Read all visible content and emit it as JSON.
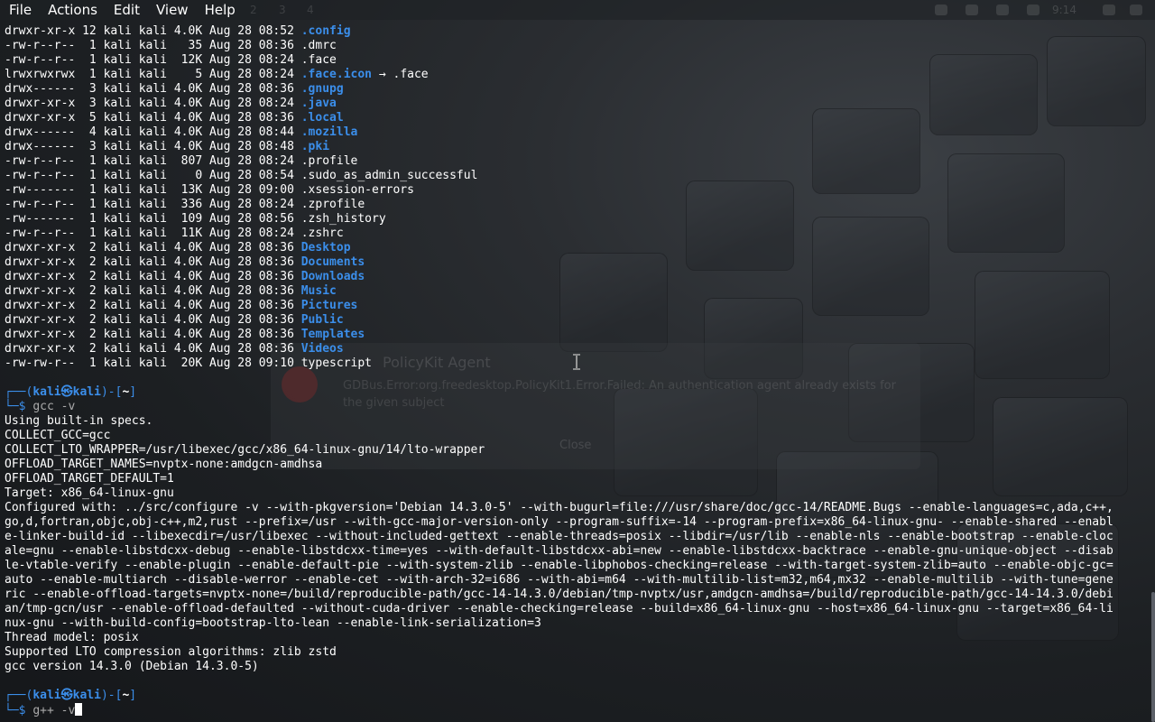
{
  "menubar": {
    "items": [
      "File",
      "Actions",
      "Edit",
      "View",
      "Help"
    ]
  },
  "panel": {
    "workspaces": [
      "1",
      "2",
      "3",
      "4"
    ],
    "clock": "9:14"
  },
  "ghost_dialog": {
    "title": "PolicyKit Agent",
    "text": "GDBus.Error:org.freedesktop.PolicyKit1.Error.Failed: An authentication agent already exists for the given subject",
    "button": "Close"
  },
  "listing": [
    {
      "perms": "drwxr-xr-x",
      "links": "12",
      "user": "kali",
      "group": "kali",
      "size": "4.0K",
      "month": "Aug",
      "day": "28",
      "time": "08:52",
      "name": ".config",
      "kind": "dir"
    },
    {
      "perms": "-rw-r--r--",
      "links": " 1",
      "user": "kali",
      "group": "kali",
      "size": "  35",
      "month": "Aug",
      "day": "28",
      "time": "08:36",
      "name": ".dmrc",
      "kind": "file"
    },
    {
      "perms": "-rw-r--r--",
      "links": " 1",
      "user": "kali",
      "group": "kali",
      "size": " 12K",
      "month": "Aug",
      "day": "28",
      "time": "08:24",
      "name": ".face",
      "kind": "file"
    },
    {
      "perms": "lrwxrwxrwx",
      "links": " 1",
      "user": "kali",
      "group": "kali",
      "size": "   5",
      "month": "Aug",
      "day": "28",
      "time": "08:24",
      "name": ".face.icon",
      "kind": "link",
      "target": " → .face"
    },
    {
      "perms": "drwx------",
      "links": " 3",
      "user": "kali",
      "group": "kali",
      "size": "4.0K",
      "month": "Aug",
      "day": "28",
      "time": "08:36",
      "name": ".gnupg",
      "kind": "dir"
    },
    {
      "perms": "drwxr-xr-x",
      "links": " 3",
      "user": "kali",
      "group": "kali",
      "size": "4.0K",
      "month": "Aug",
      "day": "28",
      "time": "08:24",
      "name": ".java",
      "kind": "dir"
    },
    {
      "perms": "drwxr-xr-x",
      "links": " 5",
      "user": "kali",
      "group": "kali",
      "size": "4.0K",
      "month": "Aug",
      "day": "28",
      "time": "08:36",
      "name": ".local",
      "kind": "dir"
    },
    {
      "perms": "drwx------",
      "links": " 4",
      "user": "kali",
      "group": "kali",
      "size": "4.0K",
      "month": "Aug",
      "day": "28",
      "time": "08:44",
      "name": ".mozilla",
      "kind": "dir"
    },
    {
      "perms": "drwx------",
      "links": " 3",
      "user": "kali",
      "group": "kali",
      "size": "4.0K",
      "month": "Aug",
      "day": "28",
      "time": "08:48",
      "name": ".pki",
      "kind": "dir"
    },
    {
      "perms": "-rw-r--r--",
      "links": " 1",
      "user": "kali",
      "group": "kali",
      "size": " 807",
      "month": "Aug",
      "day": "28",
      "time": "08:24",
      "name": ".profile",
      "kind": "file"
    },
    {
      "perms": "-rw-r--r--",
      "links": " 1",
      "user": "kali",
      "group": "kali",
      "size": "   0",
      "month": "Aug",
      "day": "28",
      "time": "08:54",
      "name": ".sudo_as_admin_successful",
      "kind": "file"
    },
    {
      "perms": "-rw-------",
      "links": " 1",
      "user": "kali",
      "group": "kali",
      "size": " 13K",
      "month": "Aug",
      "day": "28",
      "time": "09:00",
      "name": ".xsession-errors",
      "kind": "file"
    },
    {
      "perms": "-rw-r--r--",
      "links": " 1",
      "user": "kali",
      "group": "kali",
      "size": " 336",
      "month": "Aug",
      "day": "28",
      "time": "08:24",
      "name": ".zprofile",
      "kind": "file"
    },
    {
      "perms": "-rw-------",
      "links": " 1",
      "user": "kali",
      "group": "kali",
      "size": " 109",
      "month": "Aug",
      "day": "28",
      "time": "08:56",
      "name": ".zsh_history",
      "kind": "file"
    },
    {
      "perms": "-rw-r--r--",
      "links": " 1",
      "user": "kali",
      "group": "kali",
      "size": " 11K",
      "month": "Aug",
      "day": "28",
      "time": "08:24",
      "name": ".zshrc",
      "kind": "file"
    },
    {
      "perms": "drwxr-xr-x",
      "links": " 2",
      "user": "kali",
      "group": "kali",
      "size": "4.0K",
      "month": "Aug",
      "day": "28",
      "time": "08:36",
      "name": "Desktop",
      "kind": "dir"
    },
    {
      "perms": "drwxr-xr-x",
      "links": " 2",
      "user": "kali",
      "group": "kali",
      "size": "4.0K",
      "month": "Aug",
      "day": "28",
      "time": "08:36",
      "name": "Documents",
      "kind": "dir"
    },
    {
      "perms": "drwxr-xr-x",
      "links": " 2",
      "user": "kali",
      "group": "kali",
      "size": "4.0K",
      "month": "Aug",
      "day": "28",
      "time": "08:36",
      "name": "Downloads",
      "kind": "dir"
    },
    {
      "perms": "drwxr-xr-x",
      "links": " 2",
      "user": "kali",
      "group": "kali",
      "size": "4.0K",
      "month": "Aug",
      "day": "28",
      "time": "08:36",
      "name": "Music",
      "kind": "dir"
    },
    {
      "perms": "drwxr-xr-x",
      "links": " 2",
      "user": "kali",
      "group": "kali",
      "size": "4.0K",
      "month": "Aug",
      "day": "28",
      "time": "08:36",
      "name": "Pictures",
      "kind": "dir"
    },
    {
      "perms": "drwxr-xr-x",
      "links": " 2",
      "user": "kali",
      "group": "kali",
      "size": "4.0K",
      "month": "Aug",
      "day": "28",
      "time": "08:36",
      "name": "Public",
      "kind": "dir"
    },
    {
      "perms": "drwxr-xr-x",
      "links": " 2",
      "user": "kali",
      "group": "kali",
      "size": "4.0K",
      "month": "Aug",
      "day": "28",
      "time": "08:36",
      "name": "Templates",
      "kind": "dir"
    },
    {
      "perms": "drwxr-xr-x",
      "links": " 2",
      "user": "kali",
      "group": "kali",
      "size": "4.0K",
      "month": "Aug",
      "day": "28",
      "time": "08:36",
      "name": "Videos",
      "kind": "dir"
    },
    {
      "perms": "-rw-rw-r--",
      "links": " 1",
      "user": "kali",
      "group": "kali",
      "size": " 20K",
      "month": "Aug",
      "day": "28",
      "time": "09:10",
      "name": "typescript",
      "kind": "file"
    }
  ],
  "prompt": {
    "top_prefix": "┌──(",
    "user": "kali",
    "at": "㉿",
    "host": "kali",
    "mid": ")-[",
    "cwd": "~",
    "end": "]",
    "bottom_prefix": "└─$ "
  },
  "command1": "gcc -v",
  "gcc_output": [
    "Using built-in specs.",
    "COLLECT_GCC=gcc",
    "COLLECT_LTO_WRAPPER=/usr/libexec/gcc/x86_64-linux-gnu/14/lto-wrapper",
    "OFFLOAD_TARGET_NAMES=nvptx-none:amdgcn-amdhsa",
    "OFFLOAD_TARGET_DEFAULT=1",
    "Target: x86_64-linux-gnu",
    "Configured with: ../src/configure -v --with-pkgversion='Debian 14.3.0-5' --with-bugurl=file:///usr/share/doc/gcc-14/README.Bugs --enable-languages=c,ada,c++,",
    "go,d,fortran,objc,obj-c++,m2,rust --prefix=/usr --with-gcc-major-version-only --program-suffix=-14 --program-prefix=x86_64-linux-gnu- --enable-shared --enabl",
    "e-linker-build-id --libexecdir=/usr/libexec --without-included-gettext --enable-threads=posix --libdir=/usr/lib --enable-nls --enable-bootstrap --enable-cloc",
    "ale=gnu --enable-libstdcxx-debug --enable-libstdcxx-time=yes --with-default-libstdcxx-abi=new --enable-libstdcxx-backtrace --enable-gnu-unique-object --disab",
    "le-vtable-verify --enable-plugin --enable-default-pie --with-system-zlib --enable-libphobos-checking=release --with-target-system-zlib=auto --enable-objc-gc=",
    "auto --enable-multiarch --disable-werror --enable-cet --with-arch-32=i686 --with-abi=m64 --with-multilib-list=m32,m64,mx32 --enable-multilib --with-tune=gene",
    "ric --enable-offload-targets=nvptx-none=/build/reproducible-path/gcc-14-14.3.0/debian/tmp-nvptx/usr,amdgcn-amdhsa=/build/reproducible-path/gcc-14-14.3.0/debi",
    "an/tmp-gcn/usr --enable-offload-defaulted --without-cuda-driver --enable-checking=release --build=x86_64-linux-gnu --host=x86_64-linux-gnu --target=x86_64-li",
    "nux-gnu --with-build-config=bootstrap-lto-lean --enable-link-serialization=3",
    "Thread model: posix",
    "Supported LTO compression algorithms: zlib zstd",
    "gcc version 14.3.0 (Debian 14.3.0-5)"
  ],
  "command2": "g++ -v"
}
